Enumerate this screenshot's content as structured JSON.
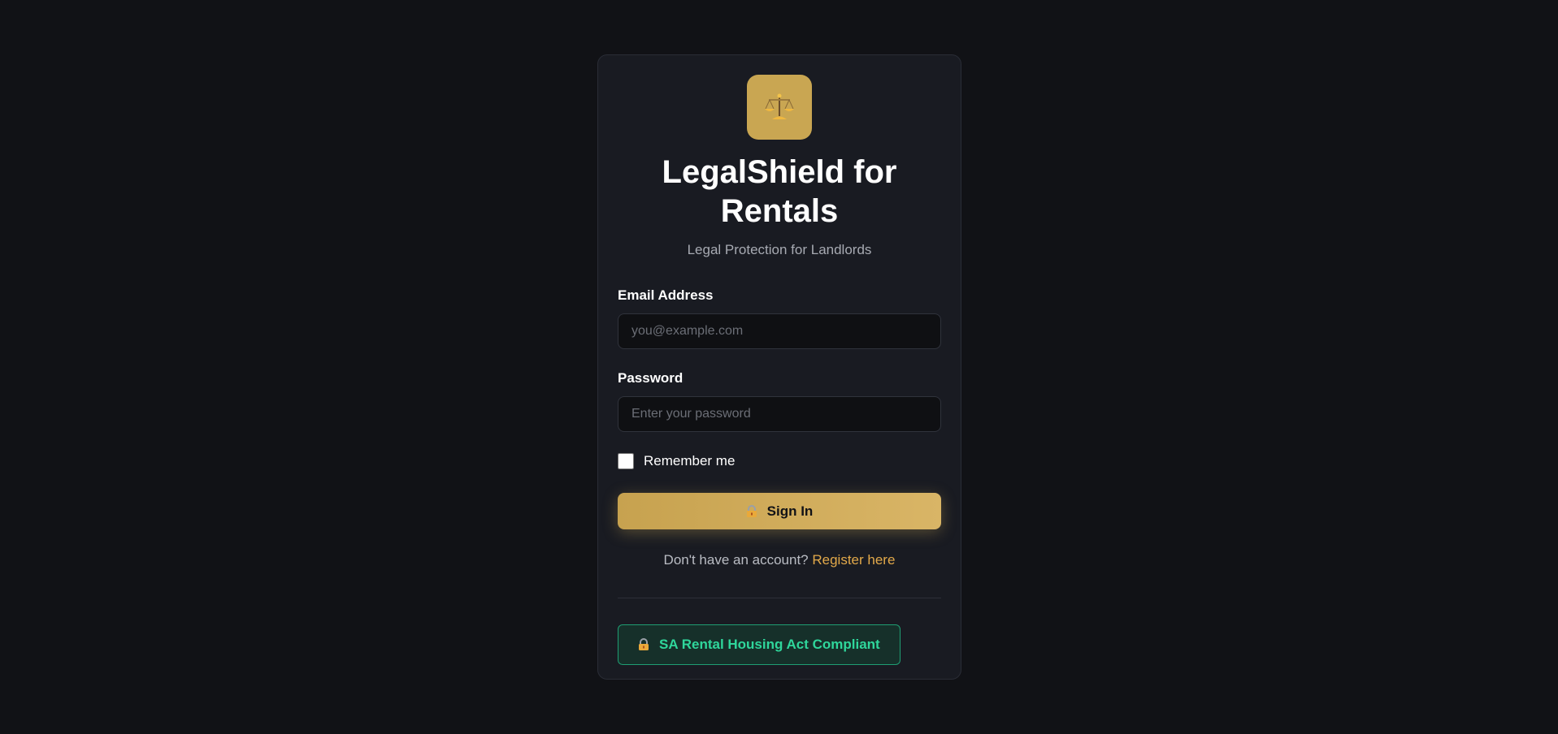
{
  "brand": {
    "logo_icon": "scales-icon",
    "title": "LegalShield for Rentals",
    "subtitle": "Legal Protection for Landlords",
    "accent_color": "#c9a652"
  },
  "form": {
    "email_label": "Email Address",
    "email_placeholder": "you@example.com",
    "email_value": "",
    "password_label": "Password",
    "password_placeholder": "Enter your password",
    "password_value": "",
    "remember_label": "Remember me",
    "remember_checked": false,
    "signin_icon": "lock-icon",
    "signin_label": "Sign In"
  },
  "register": {
    "prompt": "Don't have an account?",
    "link_label": "Register here",
    "link_color": "#e2a94a"
  },
  "compliance": {
    "icon": "lock-icon",
    "label": "SA Rental Housing Act Compliant",
    "color": "#2fd69b"
  }
}
